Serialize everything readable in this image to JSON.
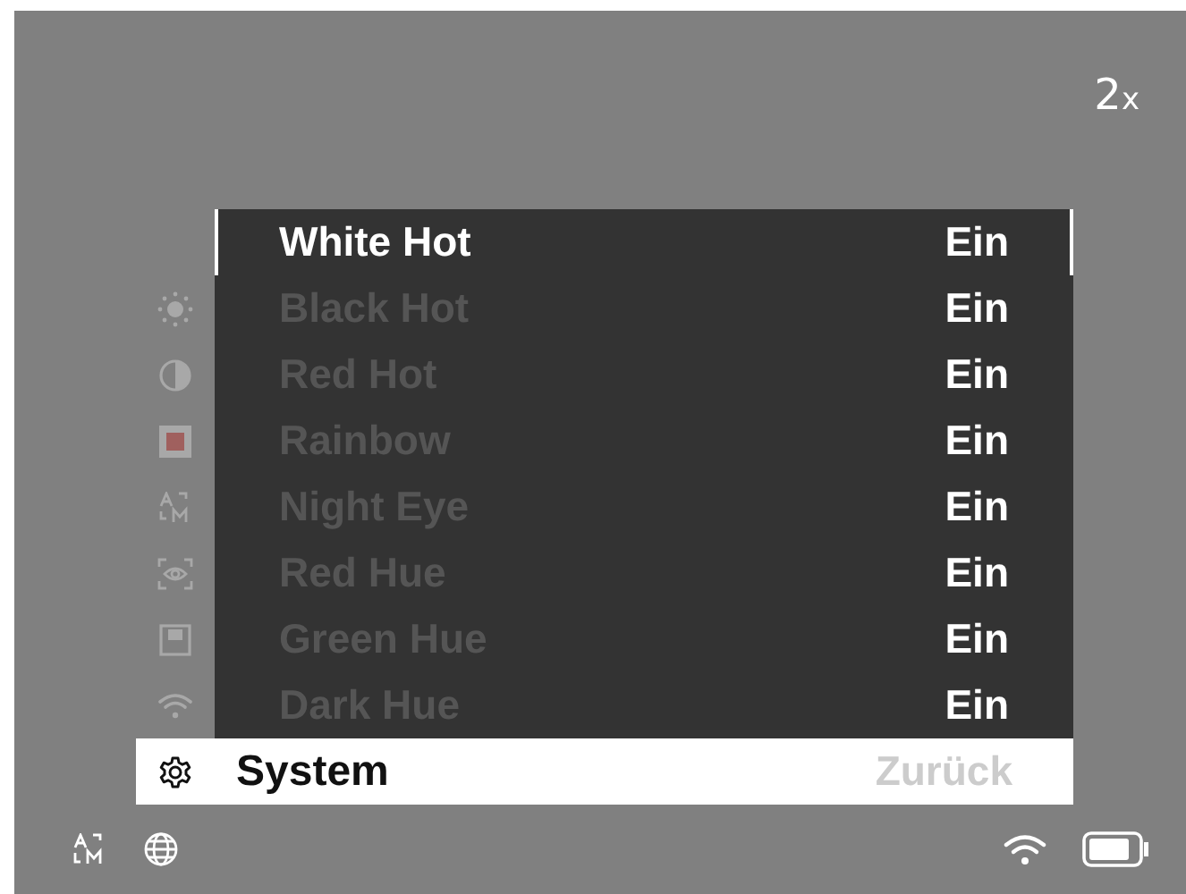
{
  "zoom": {
    "value": "2",
    "unit": "x"
  },
  "palettes": [
    {
      "label": "White Hot",
      "value": "Ein",
      "selected": true
    },
    {
      "label": "Black Hot",
      "value": "Ein",
      "selected": false
    },
    {
      "label": "Red Hot",
      "value": "Ein",
      "selected": false
    },
    {
      "label": "Rainbow",
      "value": "Ein",
      "selected": false
    },
    {
      "label": "Night Eye",
      "value": "Ein",
      "selected": false
    },
    {
      "label": "Red Hue",
      "value": "Ein",
      "selected": false
    },
    {
      "label": "Green Hue",
      "value": "Ein",
      "selected": false
    },
    {
      "label": "Dark Hue",
      "value": "Ein",
      "selected": false
    }
  ],
  "current_menu": {
    "label": "System",
    "back": "Zurück"
  }
}
